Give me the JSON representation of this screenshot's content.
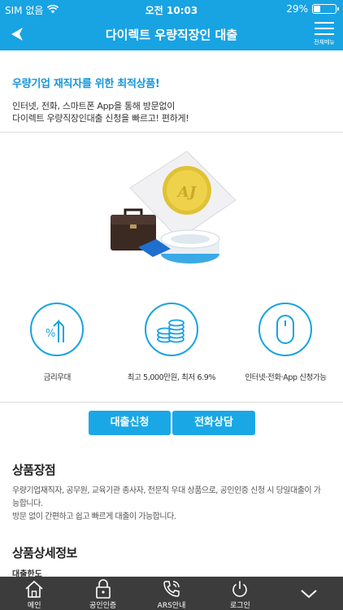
{
  "status_bar": {
    "carrier": "SIM 없음",
    "time": "오전 10:03",
    "battery_percent": "29%",
    "battery_level": 0.29
  },
  "header": {
    "title": "다이렉트 우량직장인 대출",
    "menu_label": "전체메뉴"
  },
  "intro": {
    "headline": "우량기업 재직자를 위한 최적상품!",
    "description_line1": "인터넷, 전화, 스마트폰 App을 통해 방문없이",
    "description_line2": "다이렉트 우량직장인대출 신청을 빠르고! 편하게!"
  },
  "features": [
    {
      "icon": "percent-up-arrow-icon",
      "label": "금리우대"
    },
    {
      "icon": "coins-stack-icon",
      "label": "최고 5,000만원, 최저 6.9%"
    },
    {
      "icon": "mouse-icon",
      "label": "인터넷·전화·App 신청가능"
    }
  ],
  "actions": {
    "apply_label": "대출신청",
    "consult_label": "전화상담"
  },
  "advantages": {
    "title": "상품장점",
    "line1": "우량기업재직자, 공무원, 교육기관 종사자, 전문직 우대 상품으로, 공인인증 신청 시 당일대출이 가",
    "line2": "능합니다.",
    "line3": "방문 없이 간편하고 쉽고 빠르게 대출이 가능합니다."
  },
  "details": {
    "title": "상품상세정보",
    "sub_label": "대출한도"
  },
  "bottom_nav": [
    {
      "icon": "home-icon",
      "label": "메인"
    },
    {
      "icon": "lock-icon",
      "label": "공인인증"
    },
    {
      "icon": "phone-icon",
      "label": "ARS안내"
    },
    {
      "icon": "power-icon",
      "label": "로그인"
    },
    {
      "icon": "chevron-down-icon",
      "label": ""
    }
  ],
  "colors": {
    "brand": "#18a3e3",
    "button": "#1aa7e6",
    "bottom_bar": "#3c3c3c"
  }
}
